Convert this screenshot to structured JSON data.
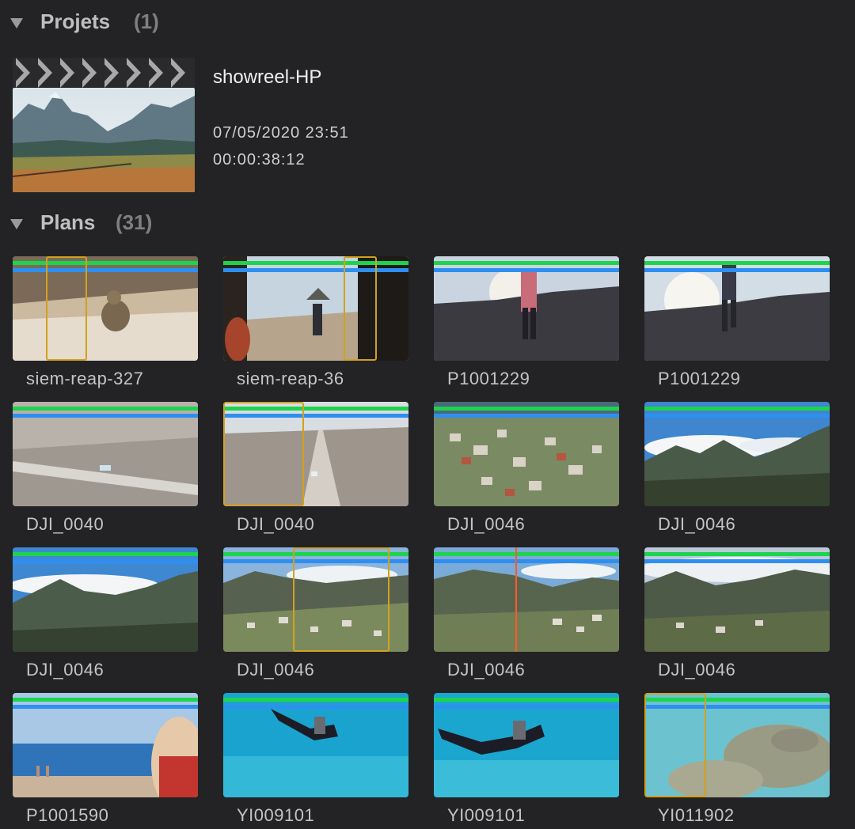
{
  "projects": {
    "title": "Projets",
    "count": "(1)"
  },
  "project": {
    "name": "showreel-HP",
    "date": "07/05/2020 23:51",
    "duration": "00:00:38:12"
  },
  "clips_section": {
    "title": "Plans",
    "count": "(31)"
  },
  "clips": [
    {
      "name": "siem-reap-327"
    },
    {
      "name": "siem-reap-36"
    },
    {
      "name": "P1001229"
    },
    {
      "name": "P1001229"
    },
    {
      "name": "DJI_0040"
    },
    {
      "name": "DJI_0040"
    },
    {
      "name": "DJI_0046"
    },
    {
      "name": "DJI_0046"
    },
    {
      "name": "DJI_0046"
    },
    {
      "name": "DJI_0046"
    },
    {
      "name": "DJI_0046"
    },
    {
      "name": "DJI_0046"
    },
    {
      "name": "P1001590"
    },
    {
      "name": "YI009101"
    },
    {
      "name": "YI009101"
    },
    {
      "name": "YI011902"
    }
  ],
  "colors": {
    "background": "#232325",
    "favorite_bar": "#1ed34e",
    "keyword_bar": "#2f8ff0",
    "selection": "#d2a11c",
    "playhead": "#ff5a2a"
  }
}
